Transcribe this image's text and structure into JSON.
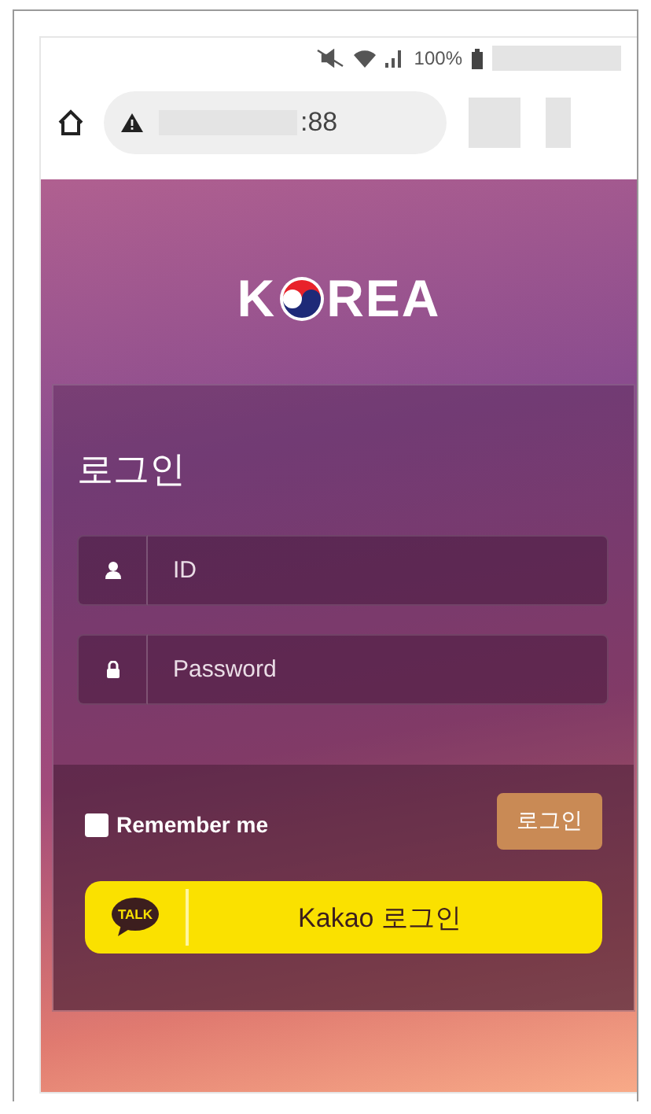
{
  "status_bar": {
    "battery": "100%"
  },
  "address_bar": {
    "url_suffix": ":88"
  },
  "logo": {
    "before": "K",
    "after": "REA"
  },
  "login_form": {
    "title": "로그인",
    "fields": [
      {
        "kind": "user",
        "placeholder": "ID"
      },
      {
        "kind": "lock",
        "placeholder": "Password"
      }
    ],
    "remember": {
      "label": "Remember me",
      "checked": false
    },
    "submit": "로그인",
    "kakao": {
      "icon_label": "TALK",
      "label": "Kakao 로그인"
    }
  }
}
